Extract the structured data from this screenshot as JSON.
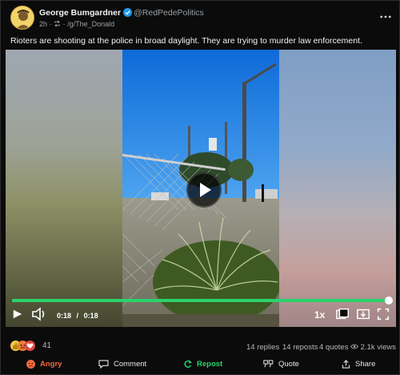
{
  "post": {
    "author_name": "George Bumgardner",
    "handle": "@RedPedePolitics",
    "time": "2h",
    "separator": "·",
    "community": "/g/The_Donald",
    "text": "Rioters are shooting at the police in broad daylight. They are trying to murder law enforcement."
  },
  "video": {
    "current_time": "0:18",
    "time_separator": "/",
    "duration": "0:18",
    "progress": 1.0,
    "speed_label": "1x"
  },
  "stats": {
    "reaction_count": "41",
    "replies": "14 replies",
    "reposts": "14 reposts",
    "quotes": "4 quotes",
    "views": "2.1k views"
  },
  "actions": {
    "react_label": "Angry",
    "comment_label": "Comment",
    "repost_label": "Repost",
    "quote_label": "Quote",
    "share_label": "Share"
  },
  "colors": {
    "accent_green": "#2bd36b",
    "angry_orange": "#f26a3c",
    "verified_blue": "#1d9bf0"
  },
  "icons": {
    "more": "ellipsis-icon",
    "play": "play-icon",
    "volume": "volume-icon",
    "pip": "picture-in-picture-icon",
    "download": "download-icon",
    "fullscreen": "fullscreen-icon"
  }
}
